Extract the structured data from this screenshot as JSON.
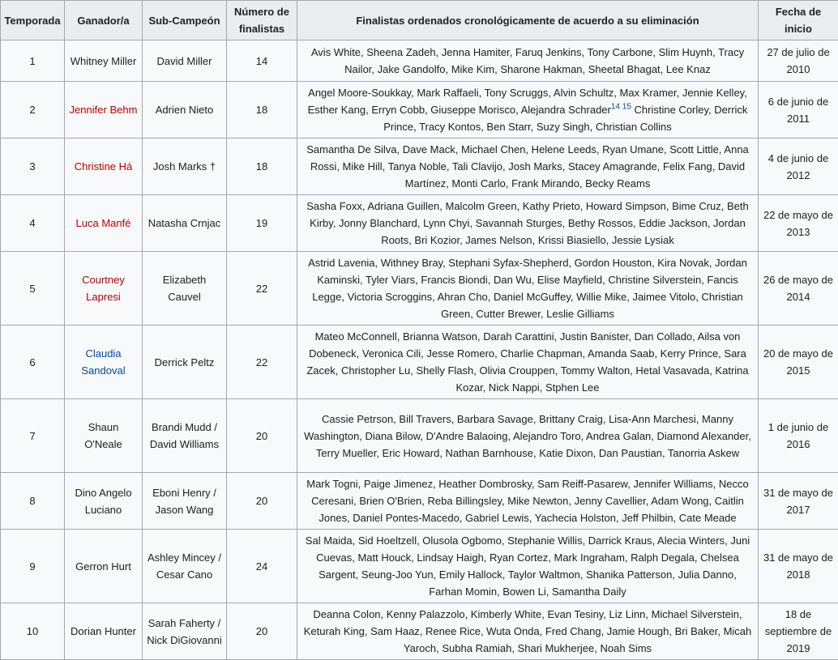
{
  "table": {
    "headers": [
      "Temporada",
      "Ganador/a",
      "Sub-Campeón",
      "Número de finalistas",
      "Finalistas ordenados cronológicamente de acuerdo a su eliminación",
      "Fecha de inicio"
    ],
    "rows": [
      {
        "season": "1",
        "winner": "Whitney Miller",
        "winner_link": "",
        "runner_up": "David Miller",
        "count": "14",
        "finalists": "Avis White, Sheena Zadeh, Jenna Hamiter, Faruq Jenkins, Tony Carbone, Slim Huynh, Tracy Nailor, Jake Gandolfo, Mike Kim, Sharone Hakman, Sheetal Bhagat, Lee Knaz",
        "ref": "",
        "finalists_after": "",
        "date": "27 de julio de 2010"
      },
      {
        "season": "2",
        "winner": "Jennifer Behm",
        "winner_link": "red",
        "runner_up": "Adrien Nieto",
        "count": "18",
        "finalists": "Angel Moore-Soukkay, Mark Raffaeli, Tony Scruggs, Alvin Schultz, Max Kramer, Jennie Kelley, Esther Kang, Erryn Cobb, Giuseppe Morisco, Alejandra Schrader",
        "ref": "14 15",
        "finalists_after": " Christine Corley, Derrick Prince, Tracy Kontos, Ben Starr, Suzy Singh, Christian Collins",
        "date": "6 de junio de 2011"
      },
      {
        "season": "3",
        "winner": "Christine Há",
        "winner_link": "red",
        "runner_up": "Josh Marks †",
        "count": "18",
        "finalists": "Samantha De Silva, Dave Mack, Michael Chen, Helene Leeds, Ryan Umane, Scott Little, Anna Rossi, Mike Hill, Tanya Noble, Tali Clavijo, Josh Marks, Stacey Amagrande, Felix Fang, David Martínez, Monti Carlo, Frank Mirando, Becky Reams",
        "ref": "",
        "finalists_after": "",
        "date": "4 de junio de 2012"
      },
      {
        "season": "4",
        "winner": "Luca Manfé",
        "winner_link": "red",
        "runner_up": "Natasha Crnjac",
        "count": "19",
        "finalists": "Sasha Foxx, Adriana Guillen, Malcolm Green, Kathy Prieto, Howard Simpson, Bime Cruz, Beth Kirby, Jonny Blanchard, Lynn Chyi, Savannah Sturges, Bethy Rossos, Eddie Jackson, Jordan Roots, Bri Kozior, James Nelson, Krissi Biasiello, Jessie Lysiak",
        "ref": "",
        "finalists_after": "",
        "date": "22 de mayo de 2013"
      },
      {
        "season": "5",
        "winner": "Courtney Lapresi",
        "winner_link": "red",
        "runner_up": "Elizabeth Cauvel",
        "count": "22",
        "finalists": "Astrid Lavenia, Withney Bray, Stephani Syfax-Shepherd, Gordon Houston, Kira Novak, Jordan Kaminski, Tyler Viars, Francis Biondi, Dan Wu, Elise Mayfield, Christine Silverstein, Fancis Legge, Victoria Scroggins, Ahran Cho, Daniel McGuffey, Willie Mike, Jaimee Vitolo, Christian Green, Cutter Brewer, Leslie Gilliams",
        "ref": "",
        "finalists_after": "",
        "date": "26 de mayo de 2014"
      },
      {
        "season": "6",
        "winner": "Claudia Sandoval",
        "winner_link": "blue",
        "runner_up": "Derrick Peltz",
        "count": "22",
        "finalists": "Mateo McConnell, Brianna Watson, Darah Carattini, Justin Banister, Dan Collado, Ailsa von Dobeneck, Veronica Cili, Jesse Romero, Charlie Chapman, Amanda Saab, Kerry Prince, Sara Zacek, Christopher Lu, Shelly Flash, Olivia Crouppen, Tommy Walton, Hetal Vasavada, Katrina Kozar, Nick Nappi, Stphen Lee",
        "ref": "",
        "finalists_after": "",
        "date": "20 de mayo de 2015"
      },
      {
        "season": "7",
        "winner": "Shaun O'Neale",
        "winner_link": "",
        "runner_up": "Brandi Mudd / David Williams",
        "count": "20",
        "finalists": "Cassie Petrson, Bill Travers, Barbara Savage, Brittany Craig, Lisa-Ann Marchesi, Manny Washington, Diana Bilow, D'Andre Balaoing, Alejandro Toro, Andrea Galan, Diamond Alexander, Terry Mueller, Eric Howard, Nathan Barnhouse, Katie Dixon, Dan Paustian, Tanorria Askew",
        "ref": "",
        "finalists_after": "",
        "date": "1 de junio de 2016"
      },
      {
        "season": "8",
        "winner": "Dino Angelo Luciano",
        "winner_link": "",
        "runner_up": "Eboni Henry / Jason Wang",
        "count": "20",
        "finalists": "Mark Togni, Paige Jimenez, Heather Dombrosky, Sam Reiff-Pasarew, Jennifer Williams, Necco Ceresani, Brien O'Brien, Reba Billingsley, Mike Newton, Jenny Cavellier, Adam Wong, Caitlin Jones, Daniel Pontes-Macedo, Gabriel Lewis, Yachecia Holston, Jeff Philbin, Cate Meade",
        "ref": "",
        "finalists_after": "",
        "date": "31 de mayo de 2017"
      },
      {
        "season": "9",
        "winner": "Gerron Hurt",
        "winner_link": "",
        "runner_up": "Ashley Mincey / Cesar Cano",
        "count": "24",
        "finalists": "Sal Maida, Sid Hoeltzell, Olusola Ogbomo, Stephanie Willis, Darrick Kraus, Alecia Winters, Juni Cuevas, Matt Houck, Lindsay Haigh, Ryan Cortez, Mark Ingraham, Ralph Degala, Chelsea Sargent, Seung-Joo Yun, Emily Hallock, Taylor Waltmon, Shanika Patterson, Julia Danno, Farhan Momin, Bowen Li, Samantha Daily",
        "ref": "",
        "finalists_after": "",
        "date": "31 de mayo de 2018"
      },
      {
        "season": "10",
        "winner": "Dorian Hunter",
        "winner_link": "",
        "runner_up": "Sarah Faherty / Nick DiGiovanni",
        "count": "20",
        "finalists": "Deanna Colon, Kenny Palazzolo, Kimberly White, Evan Tesiny, Liz Linn, Michael Silverstein, Keturah King, Sam Haaz, Renee Rice, Wuta Onda, Fred Chang, Jamie Hough, Bri Baker, Micah Yaroch, Subha Ramiah, Shari Mukherjee, Noah Sims",
        "ref": "",
        "finalists_after": "",
        "date": "18 de septiembre de 2019"
      }
    ]
  }
}
